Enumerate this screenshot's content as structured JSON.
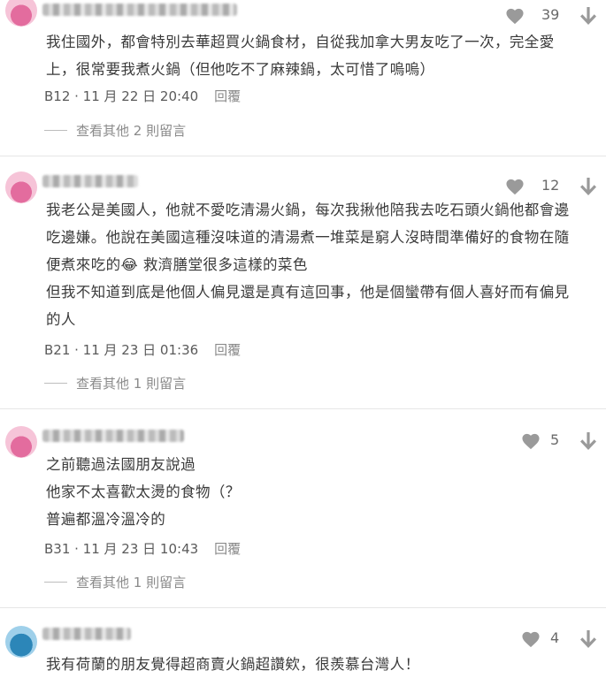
{
  "comments": [
    {
      "likes": "39",
      "lines": [
        "我住國外，都會特別去華超買火鍋食材，自從我加拿大男友吃了一次，完全愛",
        "上，很常要我煮火鍋（但他吃不了麻辣鍋，太可惜了嗚嗚）"
      ],
      "floor_time": "B12 · 11 月 22 日 20:40",
      "reply_label": "回覆",
      "more_replies": "查看其他 2 則留言"
    },
    {
      "likes": "12",
      "lines": [
        "我老公是美國人，他就不愛吃清湯火鍋，每次我揪他陪我去吃石頭火鍋他都會邊",
        "吃邊嫌。他說在美國這種沒味道的清湯煮一堆菜是窮人沒時間準備好的食物在隨",
        "便煮來吃的😂 救濟膳堂很多這樣的菜色",
        "但我不知道到底是他個人偏見還是真有這回事，他是個蠻帶有個人喜好而有偏見",
        "的人"
      ],
      "floor_time": "B21 · 11 月 23 日 01:36",
      "reply_label": "回覆",
      "more_replies": "查看其他 1 則留言"
    },
    {
      "likes": "5",
      "lines": [
        "之前聽過法國朋友說過",
        "他家不太喜歡太燙的食物（？",
        "普遍都溫冷溫冷的"
      ],
      "floor_time": "B31 · 11 月 23 日 10:43",
      "reply_label": "回覆",
      "more_replies": "查看其他 1 則留言"
    },
    {
      "likes": "4",
      "lines": [
        "我有荷蘭的朋友覺得超商賣火鍋超讚欸，很羨慕台灣人！"
      ]
    }
  ],
  "icons": {
    "like": "heart-icon",
    "dislike": "arrow-down-icon"
  },
  "colors": {
    "icon_gray": "#9a9a9a",
    "avatar_pink": "#e36c9e",
    "avatar_blue": "#2c86b8"
  }
}
